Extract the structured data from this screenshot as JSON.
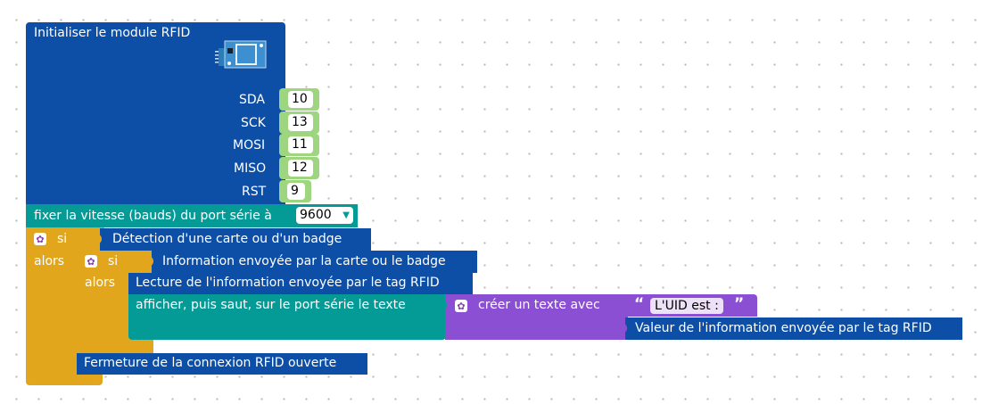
{
  "rfid_init": {
    "title": "Initialiser le module RFID",
    "pins": [
      {
        "label": "SDA",
        "value": "10"
      },
      {
        "label": "SCK",
        "value": "13"
      },
      {
        "label": "MOSI",
        "value": "11"
      },
      {
        "label": "MISO",
        "value": "12"
      },
      {
        "label": "RST",
        "value": "9"
      }
    ]
  },
  "serial": {
    "label": "fixer la vitesse (bauds) du port série à",
    "baud_value": "9600"
  },
  "if_outer": {
    "si_label": "si",
    "alors_label": "alors",
    "condition": "Détection d'une carte ou d'un badge"
  },
  "if_inner": {
    "si_label": "si",
    "alors_label": "alors",
    "condition": "Information envoyée par la carte ou le badge"
  },
  "read_block": "Lecture de l'information envoyée par le tag RFID",
  "print_block": "afficher, puis saut, sur le port série le texte",
  "join_block": {
    "label": "créer un texte avec",
    "string_value": "L'UID est :",
    "open_quote": "“",
    "close_quote": "”",
    "value_block": "Valeur de l'information envoyée par le tag RFID"
  },
  "close_block": "Fermeture de la connexion RFID ouverte",
  "colors": {
    "rfid_blue": "#0d4ea6",
    "serial_teal": "#049b97",
    "control_gold": "#e2a61d",
    "text_purple": "#8b4fd4",
    "number_green": "#9ed57f"
  }
}
